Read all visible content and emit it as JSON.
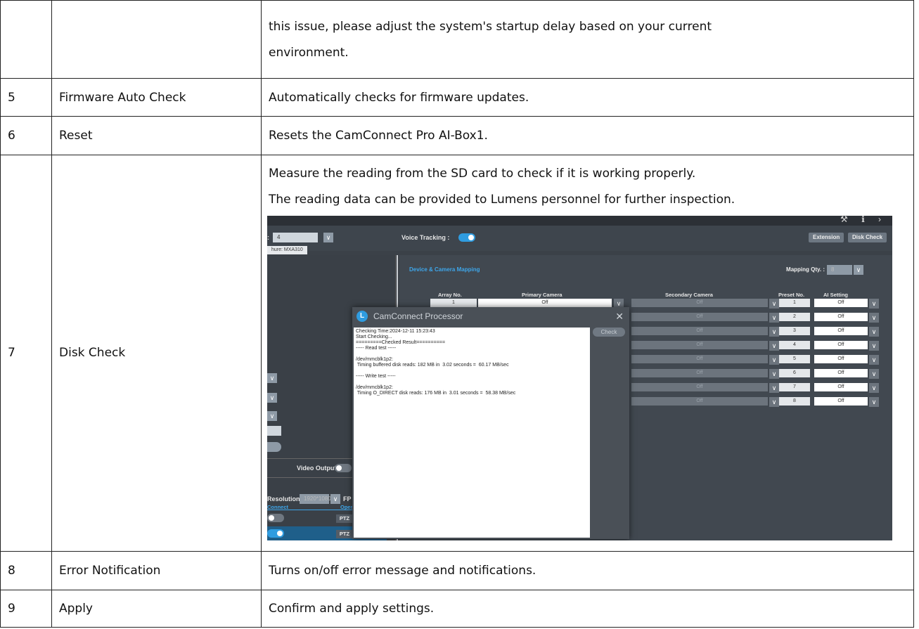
{
  "rows": [
    {
      "num": "",
      "name": "",
      "desc_lines": [
        "this issue, please adjust the system's startup delay based on your current",
        "environment."
      ]
    },
    {
      "num": "5",
      "name": "Firmware Auto Check",
      "desc_lines": [
        "Automatically checks for firmware updates."
      ]
    },
    {
      "num": "6",
      "name": "Reset",
      "desc_lines": [
        "Resets the CamConnect Pro AI-Box1."
      ]
    },
    {
      "num": "7",
      "name": "Disk Check",
      "desc_lines": [
        "Measure the reading from the SD card to check if it is working properly.",
        "The reading data can be provided to Lumens personnel for further inspection."
      ]
    },
    {
      "num": "8",
      "name": "Error Notification",
      "desc_lines": [
        "Turns on/off error message and notifications."
      ]
    },
    {
      "num": "9",
      "name": "Apply",
      "desc_lines": [
        "Confirm and apply settings."
      ]
    }
  ],
  "screenshot": {
    "array_value": "4",
    "voice_tracking_label": "Voice Tracking :",
    "extension_button": "Extension",
    "disk_check_button": "Disk Check",
    "tab_label": "hure: MXA310",
    "mapping_title": "Device & Camera Mapping",
    "mapping_qty_label": "Mapping Qty. :",
    "mapping_qty_value": "8",
    "headers": {
      "array_no": "Array No.",
      "primary": "Primary Camera",
      "secondary": "Secondary Camera",
      "preset": "Preset No.",
      "ai": "AI Setting"
    },
    "array_first": "1",
    "primary_first": "Off",
    "secondary_value": "Off",
    "presets": [
      "1",
      "2",
      "3",
      "4",
      "5",
      "6",
      "7",
      "8"
    ],
    "ai_values": [
      "Off",
      "Off",
      "Off",
      "Off",
      "Off",
      "Off",
      "Off",
      "Off"
    ],
    "dialog": {
      "title": "CamConnect Processor",
      "check_button": "Check",
      "log": "Checking Time:2024-12-11 15:23:43\nStart Checking...\n=========Checked Result==========\n----- Read test -----\n\n/dev/mmcblk1p2:\n Timing buffered disk reads: 182 MB in  3.02 seconds =  60.17 MB/sec\n\n----- Write test -----\n\n/dev/mmcblk1p2:\n Timing O_DIRECT disk reads: 176 MB in  3.01 seconds =  58.38 MB/sec"
    },
    "video_output_label": "Video Output",
    "resolution_label": "Resolution :",
    "resolution_value": "1920*1080",
    "fps_label": "FP",
    "connect_label": "Connect",
    "opera_label": "Opera",
    "ptz_label": "PTZ"
  }
}
